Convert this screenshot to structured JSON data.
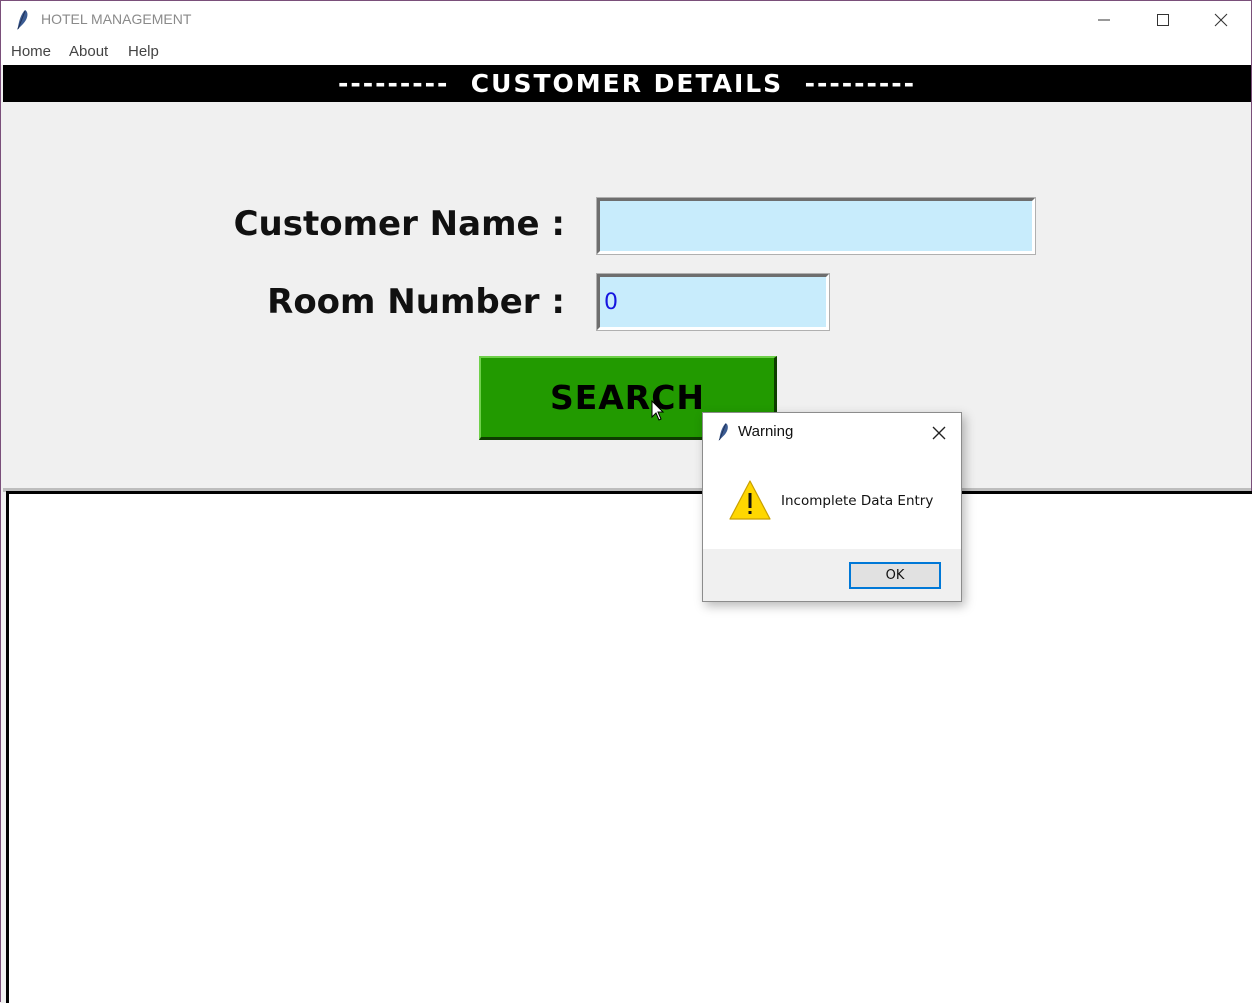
{
  "window": {
    "title": "HOTEL MANAGEMENT",
    "icon": "feather-icon"
  },
  "menu": {
    "items": [
      {
        "label": "Home"
      },
      {
        "label": "About"
      },
      {
        "label": "Help"
      }
    ]
  },
  "header": {
    "title": "---------  CUSTOMER DETAILS  ---------"
  },
  "form": {
    "customer_name_label": "Customer Name :",
    "customer_name_value": "",
    "room_number_label": "Room Number :",
    "room_number_value": "0",
    "search_button": "SEARCH"
  },
  "dialog": {
    "title": "Warning",
    "message": "Incomplete Data Entry",
    "ok_button": "OK",
    "icon": "warning-icon"
  },
  "colors": {
    "header_bg": "#000000",
    "entry_bg": "#c8ecfc",
    "entry_text": "#1515e0",
    "search_button_bg": "#229a00",
    "dialog_default_border": "#0078d7"
  }
}
